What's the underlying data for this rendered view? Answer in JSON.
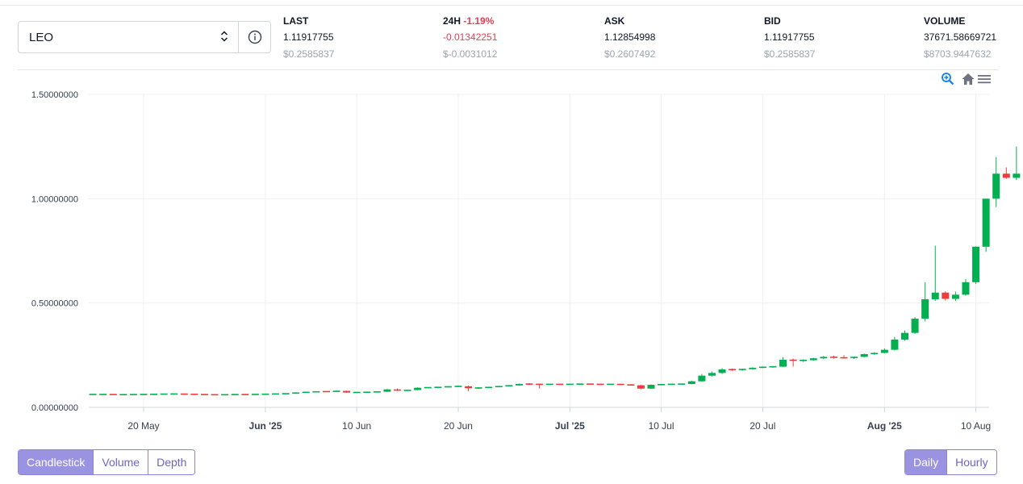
{
  "market": {
    "selected_pair": "LEO",
    "info_icon": "info-circle-icon"
  },
  "stats": {
    "last": {
      "label": "LAST",
      "value": "1.11917755",
      "usd": "$0.2585837"
    },
    "change24h": {
      "label": "24H",
      "pct": "-1.19%",
      "value": "-0.01342251",
      "usd": "$-0.0031012"
    },
    "ask": {
      "label": "ASK",
      "value": "1.12854998",
      "usd": "$0.2607492"
    },
    "bid": {
      "label": "BID",
      "value": "1.11917755",
      "usd": "$0.2585837"
    },
    "volume": {
      "label": "VOLUME",
      "value": "37671.58669721",
      "usd": "$8703.9447632"
    }
  },
  "toolbar": {
    "zoom_icon": "zoom-in-icon",
    "home_icon": "home-icon",
    "menu_icon": "menu-icon"
  },
  "chart_tabs": [
    "Candlestick",
    "Volume",
    "Depth"
  ],
  "chart_tabs_active": "Candlestick",
  "interval_tabs": [
    "Daily",
    "Hourly"
  ],
  "interval_tabs_active": "Daily",
  "colors": {
    "up": "#00b050",
    "down": "#ef3b3b",
    "negative_text": "#e53e55",
    "accent": "#9a93e2",
    "tool_blue": "#1e88e5",
    "tool_gray": "#6b7280"
  },
  "chart_data": {
    "type": "candlestick",
    "y_ticks": [
      "0.00000000",
      "0.50000000",
      "1.00000000",
      "1.50000000"
    ],
    "ylim": [
      0,
      1.5
    ],
    "x_ticks": [
      {
        "label": "20 May",
        "date": "2025-05-20",
        "bold": false
      },
      {
        "label": "Jun '25",
        "date": "2025-06-01",
        "bold": true
      },
      {
        "label": "10 Jun",
        "date": "2025-06-10",
        "bold": false
      },
      {
        "label": "20 Jun",
        "date": "2025-06-20",
        "bold": false
      },
      {
        "label": "Jul '25",
        "date": "2025-07-01",
        "bold": true
      },
      {
        "label": "10 Jul",
        "date": "2025-07-10",
        "bold": false
      },
      {
        "label": "20 Jul",
        "date": "2025-07-20",
        "bold": false
      },
      {
        "label": "Aug '25",
        "date": "2025-08-01",
        "bold": true
      },
      {
        "label": "10 Aug",
        "date": "2025-08-10",
        "bold": false
      }
    ],
    "grid": true,
    "candles": [
      {
        "d": "2025-05-15",
        "o": 0.062,
        "h": 0.063,
        "l": 0.061,
        "c": 0.062
      },
      {
        "d": "2025-05-16",
        "o": 0.062,
        "h": 0.063,
        "l": 0.061,
        "c": 0.062
      },
      {
        "d": "2025-05-17",
        "o": 0.062,
        "h": 0.063,
        "l": 0.061,
        "c": 0.061
      },
      {
        "d": "2025-05-18",
        "o": 0.061,
        "h": 0.062,
        "l": 0.06,
        "c": 0.061
      },
      {
        "d": "2025-05-19",
        "o": 0.061,
        "h": 0.062,
        "l": 0.06,
        "c": 0.062
      },
      {
        "d": "2025-05-20",
        "o": 0.062,
        "h": 0.063,
        "l": 0.061,
        "c": 0.062
      },
      {
        "d": "2025-05-21",
        "o": 0.062,
        "h": 0.064,
        "l": 0.061,
        "c": 0.063
      },
      {
        "d": "2025-05-22",
        "o": 0.063,
        "h": 0.064,
        "l": 0.062,
        "c": 0.064
      },
      {
        "d": "2025-05-23",
        "o": 0.064,
        "h": 0.065,
        "l": 0.063,
        "c": 0.064
      },
      {
        "d": "2025-05-24",
        "o": 0.064,
        "h": 0.065,
        "l": 0.063,
        "c": 0.063
      },
      {
        "d": "2025-05-25",
        "o": 0.063,
        "h": 0.064,
        "l": 0.061,
        "c": 0.062
      },
      {
        "d": "2025-05-26",
        "o": 0.062,
        "h": 0.063,
        "l": 0.06,
        "c": 0.061
      },
      {
        "d": "2025-05-27",
        "o": 0.061,
        "h": 0.062,
        "l": 0.059,
        "c": 0.06
      },
      {
        "d": "2025-05-28",
        "o": 0.06,
        "h": 0.062,
        "l": 0.059,
        "c": 0.061
      },
      {
        "d": "2025-05-29",
        "o": 0.061,
        "h": 0.062,
        "l": 0.06,
        "c": 0.062
      },
      {
        "d": "2025-05-30",
        "o": 0.062,
        "h": 0.063,
        "l": 0.06,
        "c": 0.061
      },
      {
        "d": "2025-05-31",
        "o": 0.061,
        "h": 0.063,
        "l": 0.06,
        "c": 0.063
      },
      {
        "d": "2025-06-01",
        "o": 0.063,
        "h": 0.064,
        "l": 0.062,
        "c": 0.063
      },
      {
        "d": "2025-06-02",
        "o": 0.063,
        "h": 0.066,
        "l": 0.062,
        "c": 0.065
      },
      {
        "d": "2025-06-03",
        "o": 0.065,
        "h": 0.067,
        "l": 0.064,
        "c": 0.066
      },
      {
        "d": "2025-06-04",
        "o": 0.066,
        "h": 0.072,
        "l": 0.065,
        "c": 0.071
      },
      {
        "d": "2025-06-05",
        "o": 0.071,
        "h": 0.074,
        "l": 0.07,
        "c": 0.073
      },
      {
        "d": "2025-06-06",
        "o": 0.073,
        "h": 0.077,
        "l": 0.072,
        "c": 0.076
      },
      {
        "d": "2025-06-07",
        "o": 0.076,
        "h": 0.079,
        "l": 0.074,
        "c": 0.075
      },
      {
        "d": "2025-06-08",
        "o": 0.075,
        "h": 0.08,
        "l": 0.074,
        "c": 0.079
      },
      {
        "d": "2025-06-09",
        "o": 0.079,
        "h": 0.08,
        "l": 0.07,
        "c": 0.071
      },
      {
        "d": "2025-06-10",
        "o": 0.071,
        "h": 0.073,
        "l": 0.07,
        "c": 0.072
      },
      {
        "d": "2025-06-11",
        "o": 0.072,
        "h": 0.074,
        "l": 0.071,
        "c": 0.073
      },
      {
        "d": "2025-06-12",
        "o": 0.073,
        "h": 0.076,
        "l": 0.072,
        "c": 0.075
      },
      {
        "d": "2025-06-13",
        "o": 0.075,
        "h": 0.088,
        "l": 0.074,
        "c": 0.086
      },
      {
        "d": "2025-06-14",
        "o": 0.086,
        "h": 0.09,
        "l": 0.079,
        "c": 0.08
      },
      {
        "d": "2025-06-15",
        "o": 0.08,
        "h": 0.084,
        "l": 0.079,
        "c": 0.083
      },
      {
        "d": "2025-06-16",
        "o": 0.083,
        "h": 0.096,
        "l": 0.082,
        "c": 0.094
      },
      {
        "d": "2025-06-17",
        "o": 0.094,
        "h": 0.097,
        "l": 0.092,
        "c": 0.095
      },
      {
        "d": "2025-06-18",
        "o": 0.095,
        "h": 0.098,
        "l": 0.094,
        "c": 0.097
      },
      {
        "d": "2025-06-19",
        "o": 0.097,
        "h": 0.102,
        "l": 0.096,
        "c": 0.1
      },
      {
        "d": "2025-06-20",
        "o": 0.1,
        "h": 0.103,
        "l": 0.098,
        "c": 0.101
      },
      {
        "d": "2025-06-21",
        "o": 0.101,
        "h": 0.104,
        "l": 0.078,
        "c": 0.092
      },
      {
        "d": "2025-06-22",
        "o": 0.092,
        "h": 0.096,
        "l": 0.088,
        "c": 0.094
      },
      {
        "d": "2025-06-23",
        "o": 0.094,
        "h": 0.098,
        "l": 0.093,
        "c": 0.097
      },
      {
        "d": "2025-06-24",
        "o": 0.097,
        "h": 0.103,
        "l": 0.096,
        "c": 0.102
      },
      {
        "d": "2025-06-25",
        "o": 0.102,
        "h": 0.106,
        "l": 0.101,
        "c": 0.105
      },
      {
        "d": "2025-06-26",
        "o": 0.105,
        "h": 0.114,
        "l": 0.104,
        "c": 0.112
      },
      {
        "d": "2025-06-27",
        "o": 0.112,
        "h": 0.116,
        "l": 0.108,
        "c": 0.111
      },
      {
        "d": "2025-06-28",
        "o": 0.111,
        "h": 0.114,
        "l": 0.09,
        "c": 0.11
      },
      {
        "d": "2025-06-29",
        "o": 0.11,
        "h": 0.112,
        "l": 0.108,
        "c": 0.111
      },
      {
        "d": "2025-06-30",
        "o": 0.111,
        "h": 0.113,
        "l": 0.109,
        "c": 0.11
      },
      {
        "d": "2025-07-01",
        "o": 0.11,
        "h": 0.112,
        "l": 0.108,
        "c": 0.111
      },
      {
        "d": "2025-07-02",
        "o": 0.111,
        "h": 0.113,
        "l": 0.109,
        "c": 0.112
      },
      {
        "d": "2025-07-03",
        "o": 0.112,
        "h": 0.113,
        "l": 0.11,
        "c": 0.111
      },
      {
        "d": "2025-07-04",
        "o": 0.111,
        "h": 0.112,
        "l": 0.108,
        "c": 0.11
      },
      {
        "d": "2025-07-05",
        "o": 0.11,
        "h": 0.112,
        "l": 0.109,
        "c": 0.111
      },
      {
        "d": "2025-07-06",
        "o": 0.111,
        "h": 0.112,
        "l": 0.108,
        "c": 0.109
      },
      {
        "d": "2025-07-07",
        "o": 0.109,
        "h": 0.111,
        "l": 0.104,
        "c": 0.106
      },
      {
        "d": "2025-07-08",
        "o": 0.106,
        "h": 0.108,
        "l": 0.087,
        "c": 0.09
      },
      {
        "d": "2025-07-09",
        "o": 0.09,
        "h": 0.11,
        "l": 0.089,
        "c": 0.108
      },
      {
        "d": "2025-07-10",
        "o": 0.108,
        "h": 0.111,
        "l": 0.107,
        "c": 0.11
      },
      {
        "d": "2025-07-11",
        "o": 0.11,
        "h": 0.112,
        "l": 0.108,
        "c": 0.111
      },
      {
        "d": "2025-07-12",
        "o": 0.111,
        "h": 0.113,
        "l": 0.11,
        "c": 0.112
      },
      {
        "d": "2025-07-13",
        "o": 0.112,
        "h": 0.128,
        "l": 0.111,
        "c": 0.125
      },
      {
        "d": "2025-07-14",
        "o": 0.125,
        "h": 0.16,
        "l": 0.122,
        "c": 0.152
      },
      {
        "d": "2025-07-15",
        "o": 0.152,
        "h": 0.172,
        "l": 0.148,
        "c": 0.165
      },
      {
        "d": "2025-07-16",
        "o": 0.165,
        "h": 0.188,
        "l": 0.16,
        "c": 0.182
      },
      {
        "d": "2025-07-17",
        "o": 0.182,
        "h": 0.186,
        "l": 0.175,
        "c": 0.18
      },
      {
        "d": "2025-07-18",
        "o": 0.18,
        "h": 0.185,
        "l": 0.176,
        "c": 0.183
      },
      {
        "d": "2025-07-19",
        "o": 0.183,
        "h": 0.192,
        "l": 0.181,
        "c": 0.19
      },
      {
        "d": "2025-07-20",
        "o": 0.19,
        "h": 0.196,
        "l": 0.188,
        "c": 0.194
      },
      {
        "d": "2025-07-21",
        "o": 0.194,
        "h": 0.198,
        "l": 0.19,
        "c": 0.195
      },
      {
        "d": "2025-07-22",
        "o": 0.195,
        "h": 0.24,
        "l": 0.193,
        "c": 0.228
      },
      {
        "d": "2025-07-23",
        "o": 0.228,
        "h": 0.234,
        "l": 0.196,
        "c": 0.224
      },
      {
        "d": "2025-07-24",
        "o": 0.224,
        "h": 0.23,
        "l": 0.218,
        "c": 0.226
      },
      {
        "d": "2025-07-25",
        "o": 0.226,
        "h": 0.238,
        "l": 0.224,
        "c": 0.235
      },
      {
        "d": "2025-07-26",
        "o": 0.235,
        "h": 0.246,
        "l": 0.232,
        "c": 0.242
      },
      {
        "d": "2025-07-27",
        "o": 0.242,
        "h": 0.248,
        "l": 0.234,
        "c": 0.238
      },
      {
        "d": "2025-07-28",
        "o": 0.238,
        "h": 0.25,
        "l": 0.234,
        "c": 0.237
      },
      {
        "d": "2025-07-29",
        "o": 0.237,
        "h": 0.244,
        "l": 0.232,
        "c": 0.242
      },
      {
        "d": "2025-07-30",
        "o": 0.242,
        "h": 0.258,
        "l": 0.24,
        "c": 0.255
      },
      {
        "d": "2025-07-31",
        "o": 0.255,
        "h": 0.264,
        "l": 0.252,
        "c": 0.261
      },
      {
        "d": "2025-08-01",
        "o": 0.261,
        "h": 0.282,
        "l": 0.258,
        "c": 0.276
      },
      {
        "d": "2025-08-02",
        "o": 0.276,
        "h": 0.338,
        "l": 0.272,
        "c": 0.325
      },
      {
        "d": "2025-08-03",
        "o": 0.325,
        "h": 0.368,
        "l": 0.32,
        "c": 0.357
      },
      {
        "d": "2025-08-04",
        "o": 0.357,
        "h": 0.432,
        "l": 0.352,
        "c": 0.425
      },
      {
        "d": "2025-08-05",
        "o": 0.425,
        "h": 0.6,
        "l": 0.412,
        "c": 0.518
      },
      {
        "d": "2025-08-06",
        "o": 0.518,
        "h": 0.775,
        "l": 0.51,
        "c": 0.55
      },
      {
        "d": "2025-08-07",
        "o": 0.55,
        "h": 0.556,
        "l": 0.512,
        "c": 0.52
      },
      {
        "d": "2025-08-08",
        "o": 0.52,
        "h": 0.555,
        "l": 0.51,
        "c": 0.54
      },
      {
        "d": "2025-08-09",
        "o": 0.54,
        "h": 0.615,
        "l": 0.535,
        "c": 0.6
      },
      {
        "d": "2025-08-10",
        "o": 0.6,
        "h": 0.772,
        "l": 0.592,
        "c": 0.77
      },
      {
        "d": "2025-08-11",
        "o": 0.77,
        "h": 1.0,
        "l": 0.745,
        "c": 1.0
      },
      {
        "d": "2025-08-12",
        "o": 1.0,
        "h": 1.2,
        "l": 0.96,
        "c": 1.12
      },
      {
        "d": "2025-08-13",
        "o": 1.12,
        "h": 1.15,
        "l": 1.095,
        "c": 1.1
      },
      {
        "d": "2025-08-14",
        "o": 1.1,
        "h": 1.25,
        "l": 1.09,
        "c": 1.12
      }
    ]
  }
}
